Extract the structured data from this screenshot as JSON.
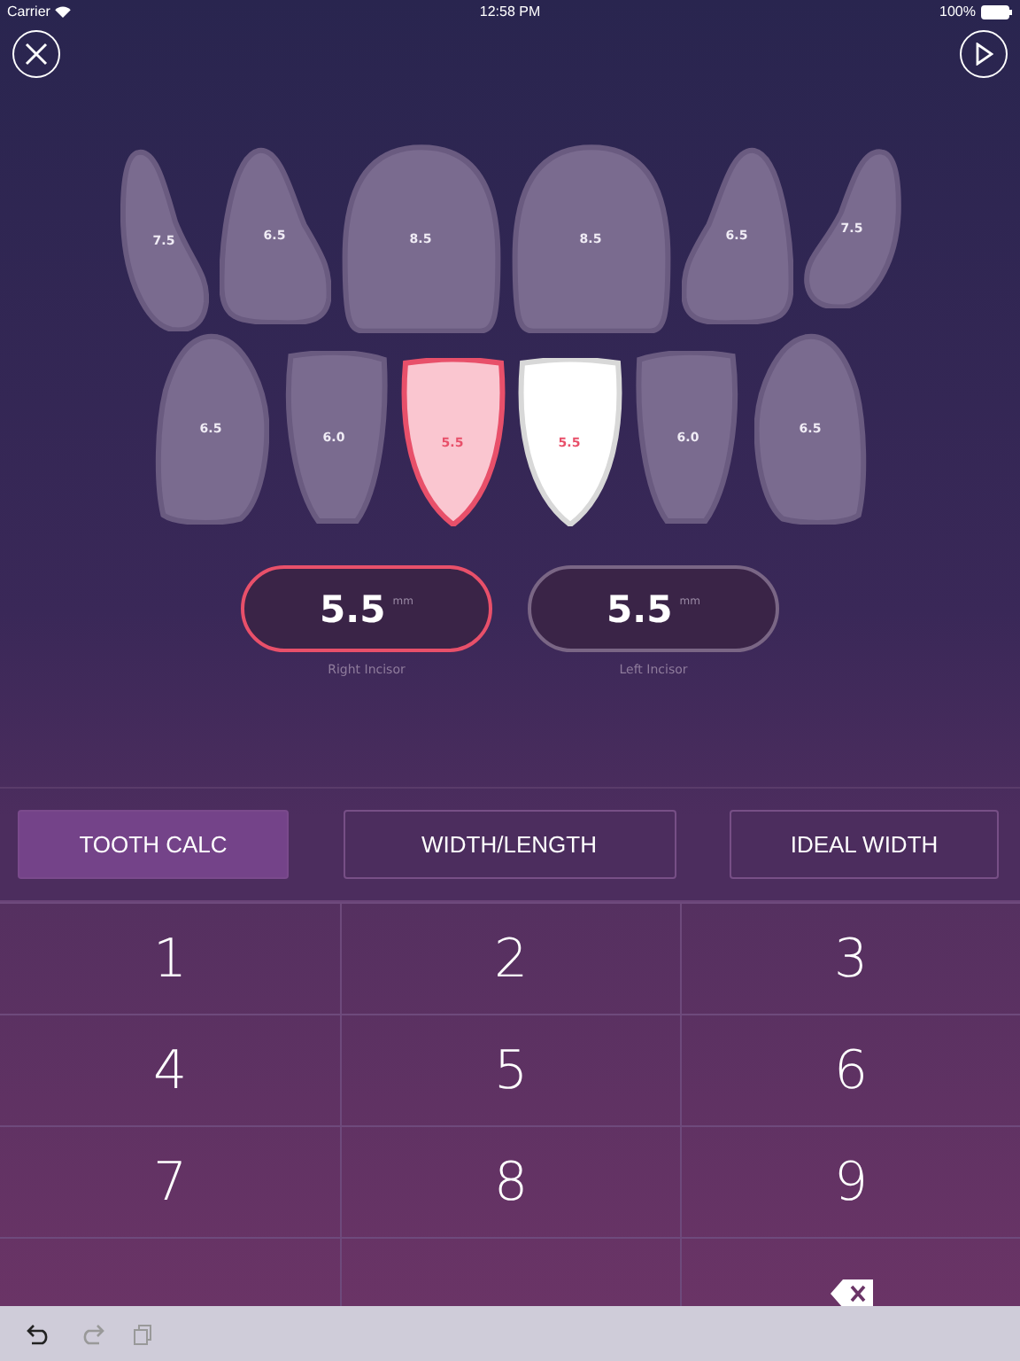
{
  "status_bar": {
    "carrier": "Carrier",
    "time": "12:58 PM",
    "battery": "100%"
  },
  "upper_teeth": [
    {
      "label": "7.5"
    },
    {
      "label": "6.5"
    },
    {
      "label": "8.5"
    },
    {
      "label": "8.5"
    },
    {
      "label": "6.5"
    },
    {
      "label": "7.5"
    }
  ],
  "lower_teeth": [
    {
      "label": "6.5",
      "selected": false,
      "color": "#7a6b8f"
    },
    {
      "label": "6.0",
      "selected": false,
      "color": "#7a6b8f"
    },
    {
      "label": "5.5",
      "selected": true,
      "color": "#fac6d0"
    },
    {
      "label": "5.5",
      "selected": false,
      "color": "#ffffff"
    },
    {
      "label": "6.0",
      "selected": false,
      "color": "#7a6b8f"
    },
    {
      "label": "6.5",
      "selected": false,
      "color": "#7a6b8f"
    }
  ],
  "measurements": [
    {
      "value": "5.5",
      "unit": "mm",
      "caption": "Right Incisor",
      "selected": true
    },
    {
      "value": "5.5",
      "unit": "mm",
      "caption": "Left Incisor",
      "selected": false
    }
  ],
  "tabs": [
    {
      "label": "TOOTH CALC",
      "selected": true
    },
    {
      "label": "WIDTH/LENGTH",
      "selected": false
    },
    {
      "label": "IDEAL WIDTH",
      "selected": false
    }
  ],
  "keys": [
    {
      "kind": "digit",
      "label": "1"
    },
    {
      "kind": "digit",
      "label": "2"
    },
    {
      "kind": "digit",
      "label": "3"
    },
    {
      "kind": "digit",
      "label": "4"
    },
    {
      "kind": "digit",
      "label": "5"
    },
    {
      "kind": "digit",
      "label": "6"
    },
    {
      "kind": "digit",
      "label": "7"
    },
    {
      "kind": "digit",
      "label": "8"
    },
    {
      "kind": "digit",
      "label": "9"
    },
    {
      "kind": "blank"
    },
    {
      "kind": "blank"
    },
    {
      "kind": "backspace"
    }
  ]
}
